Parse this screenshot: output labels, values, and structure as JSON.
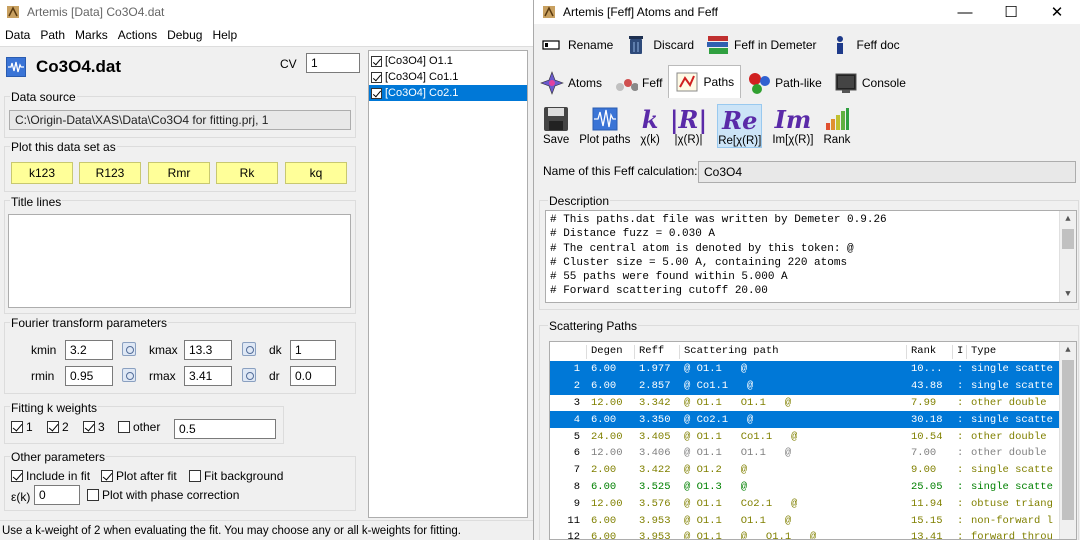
{
  "data_window": {
    "title": "Artemis [Data] Co3O4.dat",
    "menu": [
      "Data",
      "Path",
      "Marks",
      "Actions",
      "Debug",
      "Help"
    ],
    "data_title": "Co3O4.dat",
    "cv_label": "CV",
    "cv_value": "1",
    "data_source_title": "Data source",
    "data_source_value": "C:\\Origin-Data\\XAS\\Data\\Co3O4 for fitting.prj, 1",
    "plot_title": "Plot this data set as",
    "plot_buttons": [
      "k123",
      "R123",
      "Rmr",
      "Rk",
      "kq"
    ],
    "title_lines_title": "Title lines",
    "ft_title": "Fourier transform parameters",
    "ft": {
      "kmin_label": "kmin",
      "kmin": "3.2",
      "kmax_label": "kmax",
      "kmax": "13.3",
      "dk_label": "dk",
      "dk": "1",
      "rmin_label": "rmin",
      "rmin": "0.95",
      "rmax_label": "rmax",
      "rmax": "3.41",
      "dr_label": "dr",
      "dr": "0.0"
    },
    "kw_title": "Fitting k weights",
    "kw": {
      "k1": "1",
      "k2": "2",
      "k3": "3",
      "other": "other",
      "other_value": "0.5"
    },
    "other_title": "Other parameters",
    "other": {
      "include": "Include in fit",
      "plot_after": "Plot after fit",
      "fit_bkg": "Fit background",
      "eps_label": "ε(k)",
      "eps_value": "0",
      "phase": "Plot with phase correction"
    },
    "status": "Use a k-weight of 2 when evaluating the fit.  You may choose any or all k-weights for fitting.",
    "list": [
      "[Co3O4] O1.1",
      "[Co3O4] Co1.1",
      "[Co3O4] Co2.1"
    ]
  },
  "feff_window": {
    "title": "Artemis [Feff] Atoms and Feff",
    "toolbar": [
      "Rename",
      "Discard",
      "Feff in Demeter",
      "Feff doc"
    ],
    "tabs": [
      "Atoms",
      "Feff",
      "Paths",
      "Path-like",
      "Console"
    ],
    "path_tools": [
      "Save",
      "Plot paths",
      "χ(k)",
      "|χ(R)|",
      "Re[χ(R)]",
      "Im[χ(R)]",
      "Rank"
    ],
    "name_label": "Name of this Feff calculation:",
    "name_value": "Co3O4",
    "desc_title": "Description",
    "description": [
      "# This paths.dat file was written by Demeter 0.9.26",
      "# Distance fuzz = 0.030 A",
      "# The central atom is denoted by this token: @",
      "# Cluster size = 5.00 A, containing 220 atoms",
      "# 55 paths were found within 5.000 A",
      "# Forward scattering cutoff 20.00"
    ],
    "paths_title": "Scattering Paths",
    "columns": [
      "",
      "Degen",
      "Reff",
      "Scattering path",
      "Rank",
      "I",
      "Type"
    ],
    "rows": [
      {
        "n": "1",
        "degen": "6.00",
        "reff": "1.977",
        "path": "@ O1.1   @",
        "rank": "10...",
        "i": ":",
        "type": "single scatte",
        "sel": true
      },
      {
        "n": "2",
        "degen": "6.00",
        "reff": "2.857",
        "path": "@ Co1.1   @",
        "rank": "43.88",
        "i": ":",
        "type": "single scatte",
        "sel": true
      },
      {
        "n": "3",
        "degen": "12.00",
        "reff": "3.342",
        "path": "@ O1.1   O1.1   @",
        "rank": "7.99",
        "i": ":",
        "type": "other double",
        "sel": false
      },
      {
        "n": "4",
        "degen": "6.00",
        "reff": "3.350",
        "path": "@ Co2.1   @",
        "rank": "30.18",
        "i": ":",
        "type": "single scatte",
        "sel": true
      },
      {
        "n": "5",
        "degen": "24.00",
        "reff": "3.405",
        "path": "@ O1.1   Co1.1   @",
        "rank": "10.54",
        "i": ":",
        "type": "other double",
        "sel": false
      },
      {
        "n": "6",
        "degen": "12.00",
        "reff": "3.406",
        "path": "@ O1.1   O1.1   @",
        "rank": "7.00",
        "i": ":",
        "type": "other double",
        "sel": false
      },
      {
        "n": "7",
        "degen": "2.00",
        "reff": "3.422",
        "path": "@ O1.2   @",
        "rank": "9.00",
        "i": ":",
        "type": "single scatte",
        "sel": false
      },
      {
        "n": "8",
        "degen": "6.00",
        "reff": "3.525",
        "path": "@ O1.3   @",
        "rank": "25.05",
        "i": ":",
        "type": "single scatte",
        "sel": false
      },
      {
        "n": "9",
        "degen": "12.00",
        "reff": "3.576",
        "path": "@ O1.1   Co2.1   @",
        "rank": "11.94",
        "i": ":",
        "type": "obtuse triang",
        "sel": false
      },
      {
        "n": "11",
        "degen": "6.00",
        "reff": "3.953",
        "path": "@ O1.1   O1.1   @",
        "rank": "15.15",
        "i": ":",
        "type": "non-forward l",
        "sel": false
      },
      {
        "n": "12",
        "degen": "6.00",
        "reff": "3.953",
        "path": "@ O1.1   @   O1.1   @",
        "rank": "13.41",
        "i": ":",
        "type": "forward throu",
        "sel": false
      }
    ],
    "row_colors": [
      "#008000",
      "#808080",
      "#808000",
      "#008000",
      "#808000",
      "#808080",
      "#808000",
      "#008000",
      "#808000",
      "#808000",
      "#808000"
    ]
  }
}
